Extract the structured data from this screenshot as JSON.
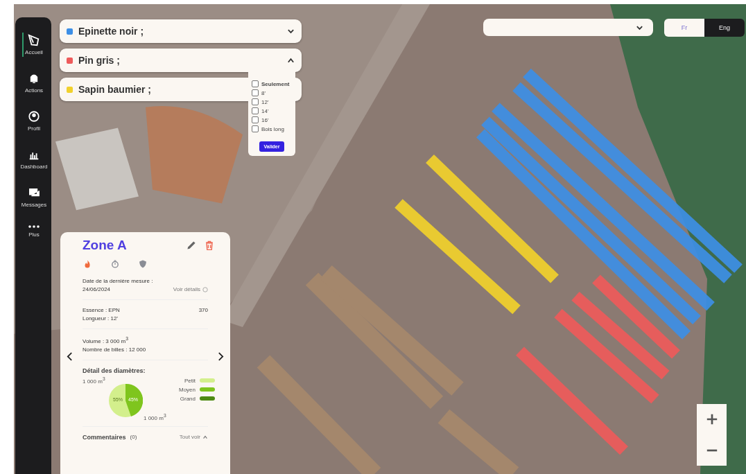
{
  "nav": [
    {
      "label": "Accueil",
      "kind": "home",
      "selected": true
    },
    {
      "label": "Actions",
      "kind": "bell",
      "selected": false
    },
    {
      "label": "Profil",
      "kind": "user",
      "selected": false
    },
    {
      "label": "Dashboard",
      "kind": "chart",
      "selected": false
    },
    {
      "label": "Messages",
      "kind": "message",
      "selected": false
    },
    {
      "label": "Plus",
      "kind": "more",
      "selected": false
    }
  ],
  "species": [
    {
      "name": "Epinette noir ;",
      "color": "#3d8fe6",
      "expanded": false
    },
    {
      "name": "Pin gris ;",
      "color": "#ee5b5b",
      "expanded": true
    },
    {
      "name": "Sapin baumier ;",
      "color": "#f1d12c",
      "expanded": false
    }
  ],
  "length_filter": {
    "options": [
      {
        "label": "Seulement",
        "checked": false
      },
      {
        "label": "8'",
        "checked": false
      },
      {
        "label": "12'",
        "checked": false
      },
      {
        "label": "14'",
        "checked": false
      },
      {
        "label": "16'",
        "checked": false
      },
      {
        "label": "Bois long",
        "checked": false
      }
    ],
    "button": "Valider"
  },
  "languages": [
    {
      "label": "Fr",
      "selected": true
    },
    {
      "label": "Eng",
      "selected": false
    }
  ],
  "zone": {
    "title": "Zone A",
    "tabs": [
      {
        "kind": "fire",
        "selected": true
      },
      {
        "kind": "stopwatch",
        "selected": false
      },
      {
        "kind": "shield",
        "selected": false
      }
    ],
    "date_label": "Date de la dernière mesure :",
    "date": "24/06/2024",
    "details_link": "Voir détails",
    "essence": "Essence : EPN",
    "count": "370",
    "length": "Longueur : 12'",
    "volume": "Volume : 3 000 m$^{3}$",
    "logs": "Nombre de billes : 12 000",
    "diameters_title": "Détail des diamètres:",
    "pie": {
      "top_label": "1 000 m$^{3}$",
      "bottom_label": "1 000 m$^{3}$",
      "left_percent": "55%",
      "right_percent": "45%"
    },
    "legend": [
      {
        "label": "Petit",
        "color": "#d3ef8c"
      },
      {
        "label": "Moyen",
        "color": "#7fc51e"
      },
      {
        "label": "Grand",
        "color": "#4e8a12"
      }
    ],
    "comments_label": "Commentaires",
    "comments_count": "(0)",
    "see_all": "Tout voir"
  }
}
